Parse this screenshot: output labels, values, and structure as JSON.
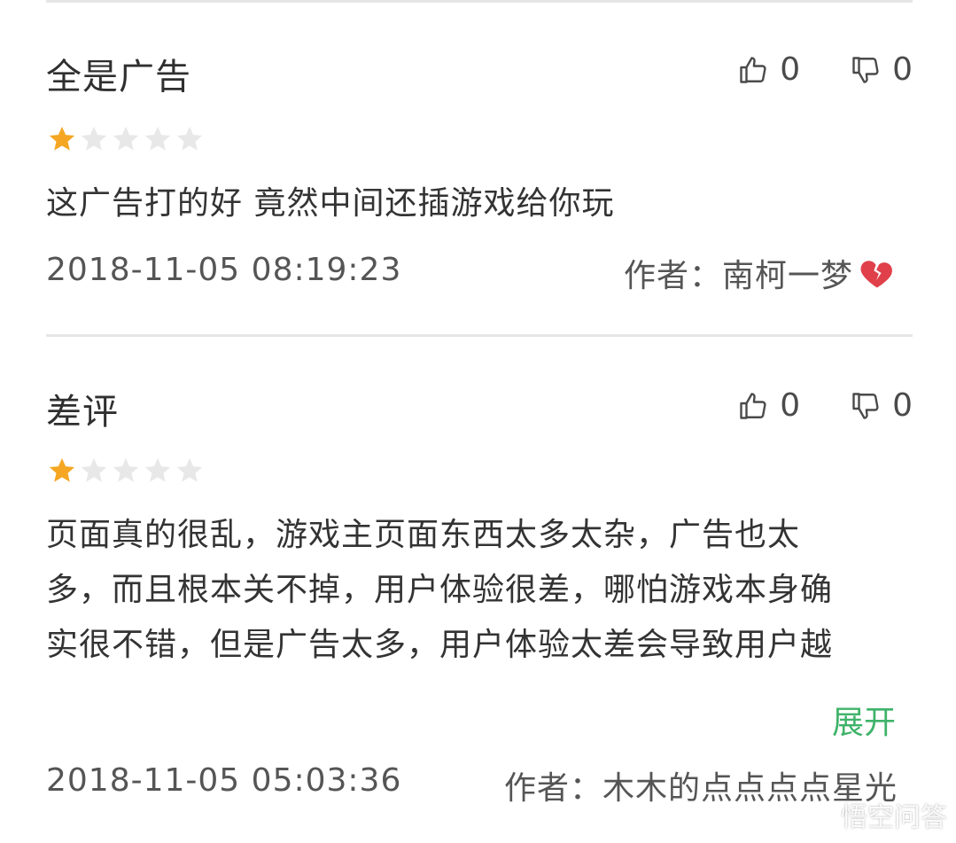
{
  "colors": {
    "star_filled": "#f5a623",
    "star_empty": "#e8e8e8",
    "expand_link": "#3fb36a",
    "heart": "#e0404a"
  },
  "reviews": [
    {
      "title": "全是广告",
      "likes": "0",
      "dislikes": "0",
      "rating": 1,
      "rating_max": 5,
      "body": "这广告打的好 竟然中间还插游戏给你玩",
      "date": "2018-11-05 08:19:23",
      "author_label": "作者：",
      "author_name": "南柯一梦",
      "author_emoji": "broken-heart-icon"
    },
    {
      "title": "差评",
      "likes": "0",
      "dislikes": "0",
      "rating": 1,
      "rating_max": 5,
      "body_lines": [
        "页面真的很乱，游戏主页面东西太多太杂，广告也太",
        "多，而且根本关不掉，用户体验很差，哪怕游戏本身确",
        "实很不错，但是广告太多，用户体验太差会导致用户越"
      ],
      "expand_label": "展开",
      "date": "2018-11-05 05:03:36",
      "author_label": "作者：",
      "author_name": "木木的点点点点星光"
    }
  ],
  "watermark": {
    "text": "悟空问答",
    "icon": "chat-bubble-icon"
  }
}
